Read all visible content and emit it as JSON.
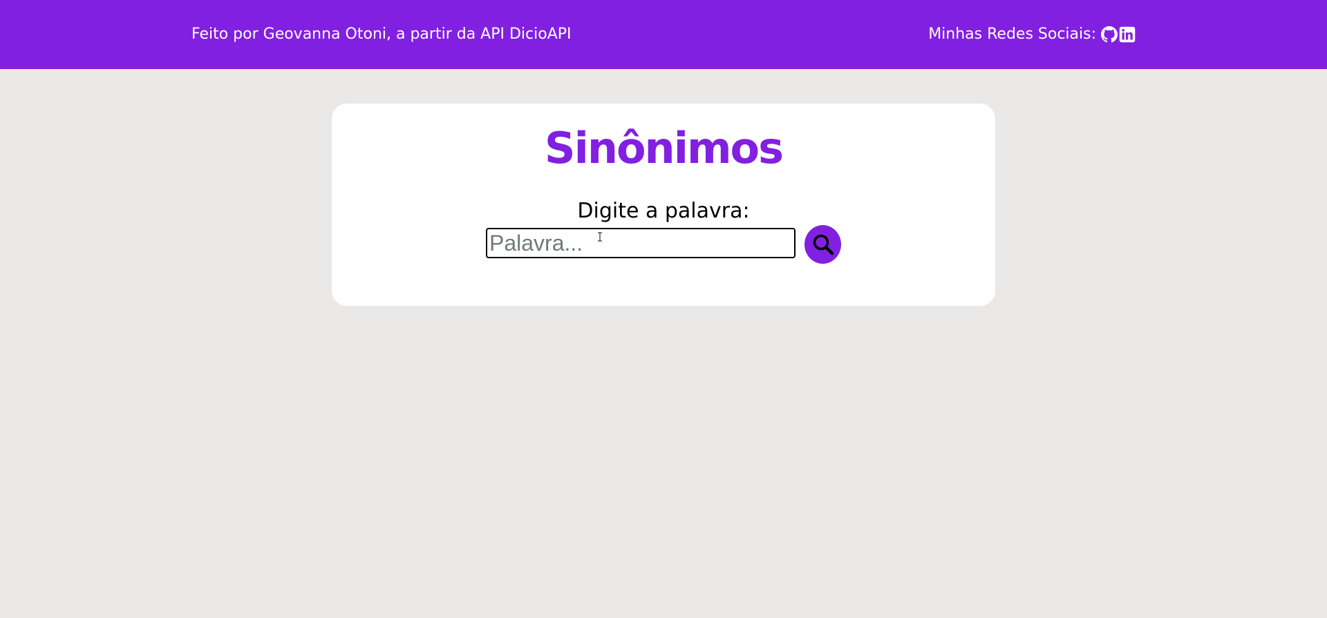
{
  "header": {
    "credit_text": "Feito por Geovanna Otoni, a partir da API DicioAPI",
    "social_label": "Minhas Redes Sociais:",
    "social_icons": [
      "github-icon",
      "linkedin-icon"
    ],
    "background_color": "#8220e1"
  },
  "main": {
    "title": "Sinônimos",
    "prompt_label": "Digite a palavra:",
    "search": {
      "placeholder": "Palavra...",
      "value": ""
    },
    "search_button_icon": "search-icon"
  },
  "colors": {
    "accent": "#8220e1",
    "page_background": "#ebe9e7",
    "card_background": "#ffffff"
  }
}
